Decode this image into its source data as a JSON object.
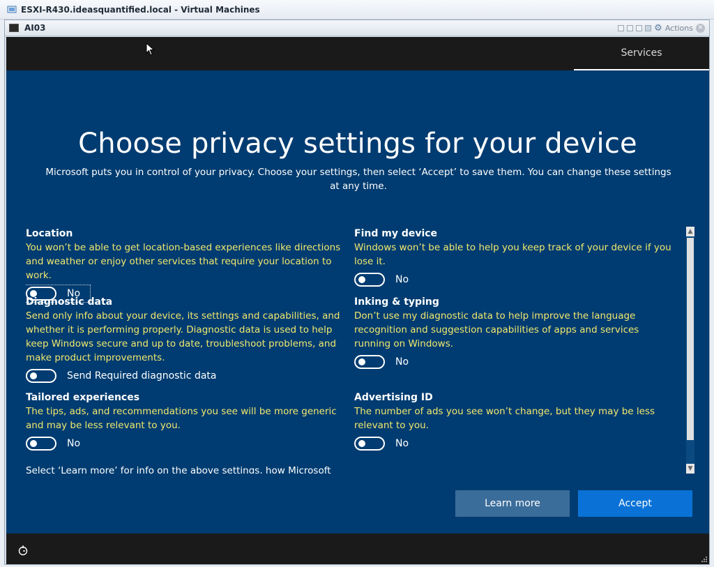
{
  "window": {
    "title": "ESXI-R430.ideasquantified.local - Virtual Machines",
    "console_name": "AI03",
    "actions_label": "Actions"
  },
  "guest": {
    "services_tab": "Services",
    "heading": "Choose privacy settings for your device",
    "subheading": "Microsoft puts you in control of your privacy. Choose your settings, then select ‘Accept’ to save them. You can change these settings at any time.",
    "settings_left": [
      {
        "title": "Location",
        "desc": "You won’t be able to get location-based experiences like directions and weather or enjoy other services that require your location to work.",
        "toggle": "No"
      },
      {
        "title": "Diagnostic data",
        "desc": "Send only info about your device, its settings and capabilities, and whether it is performing properly. Diagnostic data is used to help keep Windows secure and up to date, troubleshoot problems, and make product improvements.",
        "toggle": "Send Required diagnostic data"
      },
      {
        "title": "Tailored experiences",
        "desc": "The tips, ads, and recommendations you see will be more generic and may be less relevant to you.",
        "toggle": "No"
      }
    ],
    "settings_right": [
      {
        "title": "Find my device",
        "desc": "Windows won’t be able to help you keep track of your device if you lose it.",
        "toggle": "No"
      },
      {
        "title": "Inking & typing",
        "desc": "Don’t use my diagnostic data to help improve the language recognition and suggestion capabilities of apps and services running on Windows.",
        "toggle": "No"
      },
      {
        "title": "Advertising ID",
        "desc": "The number of ads you see won’t change, but they may be less relevant to you.",
        "toggle": "No"
      }
    ],
    "cut_text": "Select ‘Learn more’ for info on the above settings, how Microsoft",
    "learn_more": "Learn more",
    "accept": "Accept"
  },
  "colors": {
    "oobe_background": "#003c71",
    "description_text": "#f2e86d",
    "accept_button": "#0a72d6",
    "learn_more_button": "#3b6d9b"
  },
  "icons": [
    "vm-icon",
    "console-icon",
    "gear-icon",
    "close-icon",
    "ease-of-access-icon",
    "mouse-cursor-icon",
    "resize-grip-icon"
  ]
}
